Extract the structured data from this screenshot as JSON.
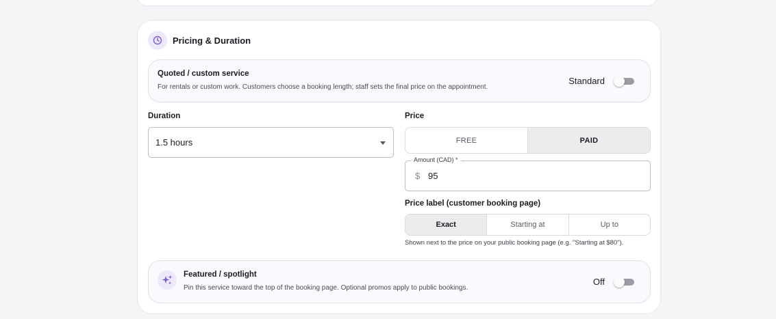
{
  "section": {
    "title": "Pricing & Duration",
    "icon": "clock-icon"
  },
  "quoted": {
    "title": "Quoted / custom service",
    "description": "For rentals or custom work. Customers choose a booking length; staff sets the final price on the appointment.",
    "toggle_label": "Standard",
    "toggle_on": false
  },
  "duration": {
    "label": "Duration",
    "value": "1.5 hours"
  },
  "price": {
    "label": "Price",
    "options": [
      "FREE",
      "PAID"
    ],
    "selected": "PAID",
    "amount_label": "Amount (CAD) *",
    "currency_symbol": "$",
    "amount_value": "95"
  },
  "price_label": {
    "label": "Price label (customer booking page)",
    "options": [
      "Exact",
      "Starting at",
      "Up to"
    ],
    "selected": "Exact",
    "helper": "Shown next to the price on your public booking page (e.g. \"Starting at $80\")."
  },
  "featured": {
    "title": "Featured / spotlight",
    "description": "Pin this service toward the top of the booking page. Optional promos apply to public bookings.",
    "toggle_label": "Off",
    "toggle_on": false,
    "icon": "sparkles-icon"
  },
  "colors": {
    "accent": "#7c5cd6",
    "accent_bg": "#ede8fb",
    "toggle_track": "#9d9aa6"
  }
}
